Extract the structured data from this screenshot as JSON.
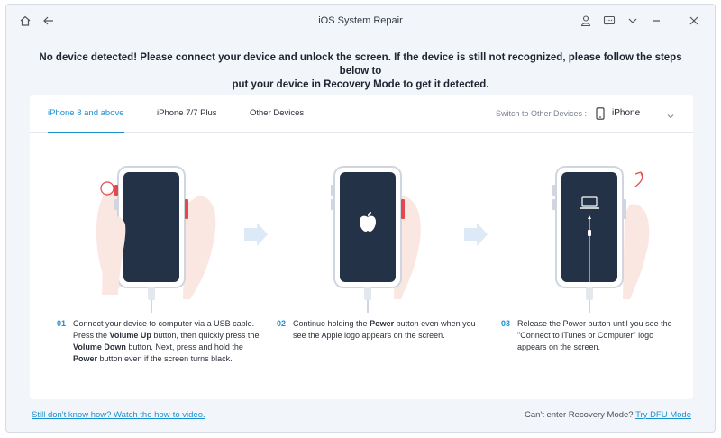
{
  "window": {
    "title": "iOS System Repair"
  },
  "headline": {
    "line1": "No device detected! Please connect your device and unlock the screen. If the device is still not recognized, please follow the steps below to",
    "line2": "put your device in Recovery Mode to get it detected."
  },
  "tabs": [
    {
      "label": "iPhone 8 and above",
      "active": true
    },
    {
      "label": "iPhone 7/7 Plus",
      "active": false
    },
    {
      "label": "Other Devices",
      "active": false
    }
  ],
  "switcher": {
    "label": "Switch to Other Devices :",
    "value": "iPhone"
  },
  "steps": [
    {
      "num": "01",
      "parts": [
        "Connect your device to computer via a USB cable. Press the ",
        "Volume Up",
        " button, then quickly press the ",
        "Volume Down",
        " button. Next, press and hold the ",
        "Power",
        " button even if the screen turns black."
      ]
    },
    {
      "num": "02",
      "parts": [
        "Continue holding the ",
        "Power",
        " button even when you see the Apple logo appears on the screen."
      ]
    },
    {
      "num": "03",
      "parts": [
        "Release the Power button until you see the \"Connect to iTunes or Computer\" logo appears on the screen."
      ]
    }
  ],
  "footer": {
    "help_link": "Still don't know how? Watch the how-to video.",
    "recovery_text": "Can't enter Recovery Mode?",
    "dfu_link": "Try DFU Mode"
  },
  "colors": {
    "accent": "#1a8fd0",
    "phone_screen": "#233247",
    "button_red": "#e0494d"
  }
}
